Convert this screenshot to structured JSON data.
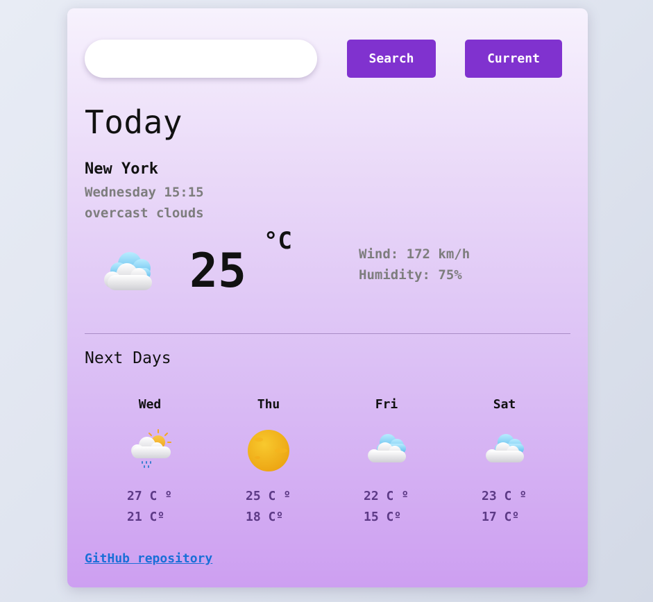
{
  "search": {
    "value": "",
    "placeholder": ""
  },
  "toolbar": {
    "search_label": "Search",
    "current_label": "Current"
  },
  "today": {
    "heading": "Today",
    "city": "New York",
    "datetime": "Wednesday 15:15",
    "condition": "overcast clouds",
    "icon": "cloud-icon",
    "temperature": "25",
    "unit": "°C",
    "wind": "Wind: 172 km/h",
    "humidity": "Humidity: 75%"
  },
  "next_days": {
    "heading": "Next Days",
    "days": [
      {
        "name": "Wed",
        "icon": "partly-cloudy-rain-icon",
        "high": "27 C º",
        "low": "21 Cº"
      },
      {
        "name": "Thu",
        "icon": "sun-icon",
        "high": "25 C º",
        "low": "18 Cº"
      },
      {
        "name": "Fri",
        "icon": "cloud-icon",
        "high": "22 C º",
        "low": "15 Cº"
      },
      {
        "name": "Sat",
        "icon": "cloud-icon",
        "high": "23 C º",
        "low": "17 Cº"
      }
    ]
  },
  "footer": {
    "link_label": "GitHub repository"
  },
  "colors": {
    "accent": "#8032cf",
    "muted_text": "#7d7d7d",
    "temp_text": "#5d3a86",
    "link": "#1a6fd8"
  }
}
